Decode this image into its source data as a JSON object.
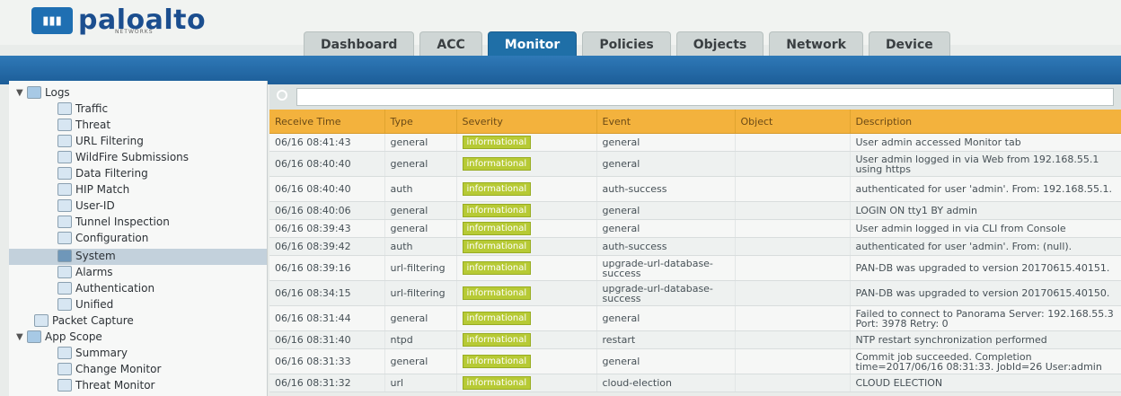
{
  "app": {
    "brand": "paloalto",
    "brand_sub": "NETWORKS",
    "logo_mark_icon": "paloalto-logo-icon"
  },
  "tabs": [
    {
      "label": "Dashboard"
    },
    {
      "label": "ACC"
    },
    {
      "label": "Monitor",
      "active": true
    },
    {
      "label": "Policies"
    },
    {
      "label": "Objects"
    },
    {
      "label": "Network"
    },
    {
      "label": "Device"
    }
  ],
  "sidebar": {
    "items": [
      {
        "label": "Logs"
      },
      {
        "label": "Traffic"
      },
      {
        "label": "Threat"
      },
      {
        "label": "URL Filtering"
      },
      {
        "label": "WildFire Submissions"
      },
      {
        "label": "Data Filtering"
      },
      {
        "label": "HIP Match"
      },
      {
        "label": "User-ID"
      },
      {
        "label": "Tunnel Inspection"
      },
      {
        "label": "Configuration"
      },
      {
        "label": "System"
      },
      {
        "label": "Alarms"
      },
      {
        "label": "Authentication"
      },
      {
        "label": "Unified"
      },
      {
        "label": "Packet Capture"
      },
      {
        "label": "App Scope"
      },
      {
        "label": "Summary"
      },
      {
        "label": "Change Monitor"
      },
      {
        "label": "Threat Monitor"
      }
    ]
  },
  "table": {
    "headers": [
      "Receive Time",
      "Type",
      "Severity",
      "Event",
      "Object",
      "Description"
    ],
    "rows": [
      {
        "time": "06/16 08:41:43",
        "type": "general",
        "severity": "informational",
        "event": "general",
        "object": "",
        "desc": "User admin accessed Monitor tab"
      },
      {
        "time": "06/16 08:40:40",
        "type": "general",
        "severity": "informational",
        "event": "general",
        "object": "",
        "desc": "User admin logged in via Web from 192.168.55.1 using https"
      },
      {
        "time": "06/16 08:40:40",
        "type": "auth",
        "severity": "informational",
        "event": "auth-success",
        "object": "",
        "desc": "authenticated for user 'admin'. From: 192.168.55.1."
      },
      {
        "time": "06/16 08:40:06",
        "type": "general",
        "severity": "informational",
        "event": "general",
        "object": "",
        "desc": "LOGIN ON tty1 BY admin"
      },
      {
        "time": "06/16 08:39:43",
        "type": "general",
        "severity": "informational",
        "event": "general",
        "object": "",
        "desc": "User admin logged in via CLI from Console"
      },
      {
        "time": "06/16 08:39:42",
        "type": "auth",
        "severity": "informational",
        "event": "auth-success",
        "object": "",
        "desc": "authenticated for user 'admin'. From: (null)."
      },
      {
        "time": "06/16 08:39:16",
        "type": "url-filtering",
        "severity": "informational",
        "event": "upgrade-url-database-success",
        "object": "",
        "desc": "PAN-DB was upgraded to version 20170615.40151."
      },
      {
        "time": "06/16 08:34:15",
        "type": "url-filtering",
        "severity": "informational",
        "event": "upgrade-url-database-success",
        "object": "",
        "desc": "PAN-DB was upgraded to version 20170615.40150."
      },
      {
        "time": "06/16 08:31:44",
        "type": "general",
        "severity": "informational",
        "event": "general",
        "object": "",
        "desc": "Failed to connect to Panorama Server: 192.168.55.3 Port: 3978 Retry: 0"
      },
      {
        "time": "06/16 08:31:40",
        "type": "ntpd",
        "severity": "informational",
        "event": "restart",
        "object": "",
        "desc": "NTP restart synchronization performed"
      },
      {
        "time": "06/16 08:31:33",
        "type": "general",
        "severity": "informational",
        "event": "general",
        "object": "",
        "desc": "Commit job succeeded. Completion time=2017/06/16 08:31:33. JobId=26 User:admin"
      },
      {
        "time": "06/16 08:31:32",
        "type": "url",
        "severity": "informational",
        "event": "cloud-election",
        "object": "",
        "desc": "CLOUD ELECTION"
      }
    ]
  }
}
